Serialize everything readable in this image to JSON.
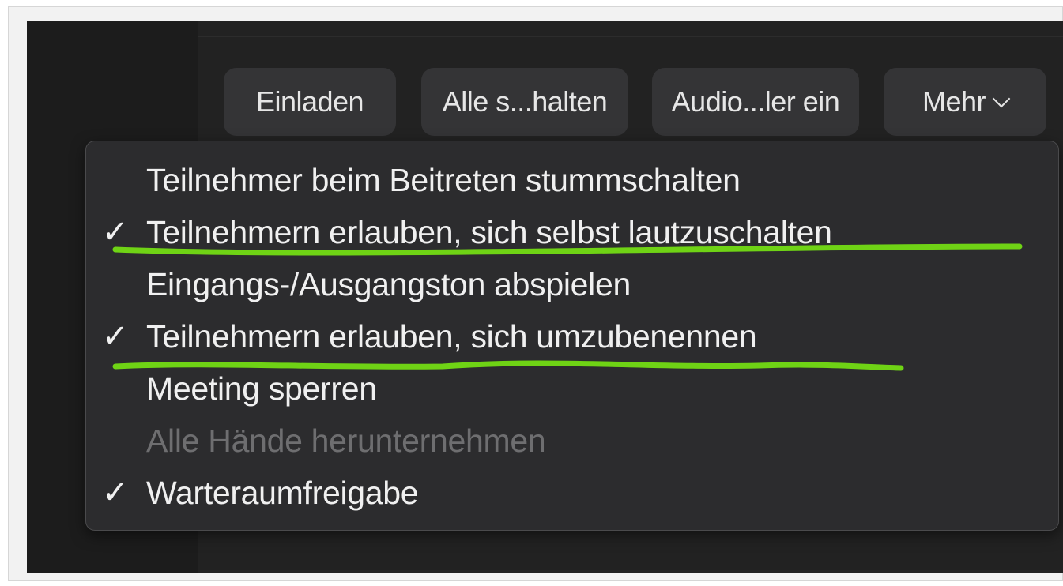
{
  "toolbar": {
    "invite_label": "Einladen",
    "mute_all_label": "Alle s...halten",
    "audio_label": "Audio...ler ein",
    "more_label": "Mehr"
  },
  "menu": {
    "items": [
      {
        "label": "Teilnehmer beim Beitreten stummschalten",
        "checked": false,
        "check_glyph": "",
        "disabled": false
      },
      {
        "label": "Teilnehmern erlauben, sich selbst lautzuschalten",
        "checked": true,
        "check_glyph": "✓",
        "disabled": false
      },
      {
        "label": "Eingangs-/Ausgangston abspielen",
        "checked": false,
        "check_glyph": "",
        "disabled": false
      },
      {
        "label": "Teilnehmern erlauben, sich umzubenennen",
        "checked": true,
        "check_glyph": "✓",
        "disabled": false
      },
      {
        "label": "Meeting sperren",
        "checked": false,
        "check_glyph": "",
        "disabled": false
      },
      {
        "label": "Alle Hände herunternehmen",
        "checked": false,
        "check_glyph": "",
        "disabled": true
      },
      {
        "label": "Warteraumfreigabe",
        "checked": true,
        "check_glyph": "✓",
        "disabled": false
      }
    ]
  },
  "icons": {
    "more_chevron": "chevron-down-icon",
    "check": "checkmark-icon"
  },
  "colors": {
    "highlight_underline": "#6fd315",
    "menu_background": "#2c2c2e",
    "button_background": "#343436",
    "disabled_text": "#6e6e70"
  }
}
